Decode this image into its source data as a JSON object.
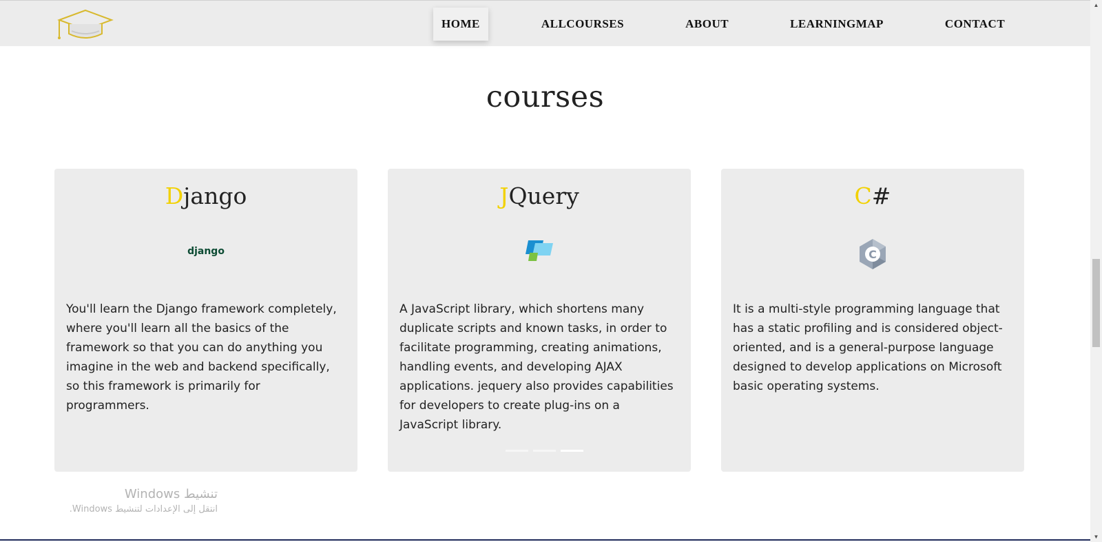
{
  "nav": {
    "items": [
      "HOME",
      "ALLCOURSES",
      "ABOUT",
      "LEARNINGMAP",
      "CONTACT"
    ],
    "active": "HOME"
  },
  "section": {
    "title": "courses"
  },
  "cards": [
    {
      "title_first": "D",
      "title_rest": "jango",
      "logo_text": "django",
      "description": "You'll learn the Django framework completely, where you'll learn all the basics of the framework so that you can do anything you imagine in the web and backend specifically, so this framework is primarily for programmers."
    },
    {
      "title_first": "J",
      "title_rest": "Query",
      "description": "A JavaScript library, which shortens many duplicate scripts and known tasks, in order to facilitate programming, creating animations, handling events, and developing AJAX applications. jequery also provides capabilities for developers to create plug-ins on a JavaScript library."
    },
    {
      "title_first": "C",
      "title_rest": "#",
      "logo_text": "C",
      "description": "It is a multi-style programming language that has a static profiling and is considered object-oriented, and is a general-purpose language designed to develop applications on Microsoft basic operating systems."
    }
  ],
  "carousel": {
    "prev_icon": "‹",
    "dots": 3,
    "active_dot": 3
  },
  "watermark": {
    "title": "تنشيط Windows",
    "subtitle": "انتقل إلى الإعدادات لتنشيط Windows."
  },
  "colors": {
    "accent": "#f2d100",
    "card_bg": "#ececec",
    "nav_bg": "#ececec"
  }
}
